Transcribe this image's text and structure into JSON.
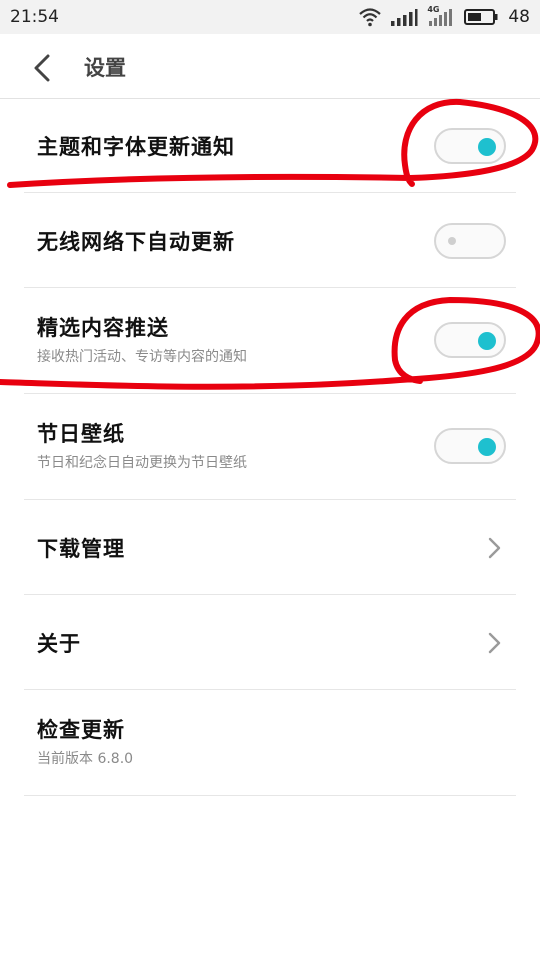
{
  "status_bar": {
    "time": "21:54",
    "network_label": "4G",
    "battery_level": "48"
  },
  "header": {
    "title": "设置"
  },
  "settings": [
    {
      "title": "主题和字体更新通知",
      "control": "toggle",
      "on": true
    },
    {
      "title": "无线网络下自动更新",
      "control": "toggle",
      "on": false
    },
    {
      "title": "精选内容推送",
      "subtitle": "接收热门活动、专访等内容的通知",
      "control": "toggle",
      "on": true
    },
    {
      "title": "节日壁纸",
      "subtitle": "节日和纪念日自动更换为节日壁纸",
      "control": "toggle",
      "on": true
    },
    {
      "title": "下载管理",
      "control": "chevron"
    },
    {
      "title": "关于",
      "control": "chevron"
    },
    {
      "title": "检查更新",
      "subtitle": "当前版本 6.8.0"
    }
  ],
  "colors": {
    "accent": "#1ec0cf",
    "annotation": "#e8000f"
  }
}
